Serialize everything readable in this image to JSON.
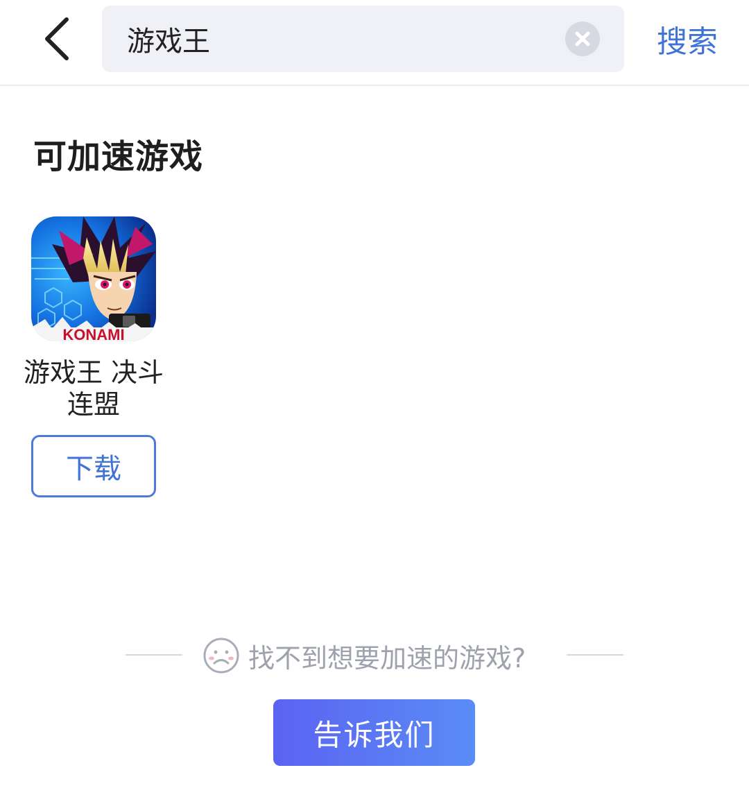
{
  "header": {
    "back_icon": "chevron-left-icon",
    "search": {
      "value": "游戏王",
      "placeholder": "",
      "clear_icon": "close-circle-icon"
    },
    "search_button_label": "搜索"
  },
  "section": {
    "title": "可加速游戏"
  },
  "games": [
    {
      "icon_brand_text": "KONAMI",
      "name": "游戏王 决斗连盟",
      "download_label": "下载"
    }
  ],
  "footer": {
    "hint_icon": "sad-face-icon",
    "hint_text": "找不到想要加速的游戏?",
    "tell_us_label": "告诉我们"
  },
  "colors": {
    "accent_blue": "#3f74d6",
    "search_bg": "#f0f1f6",
    "button_gradient_start": "#5b63f2",
    "button_gradient_end": "#5a8cf6",
    "hint_gray": "#9da2ad"
  }
}
